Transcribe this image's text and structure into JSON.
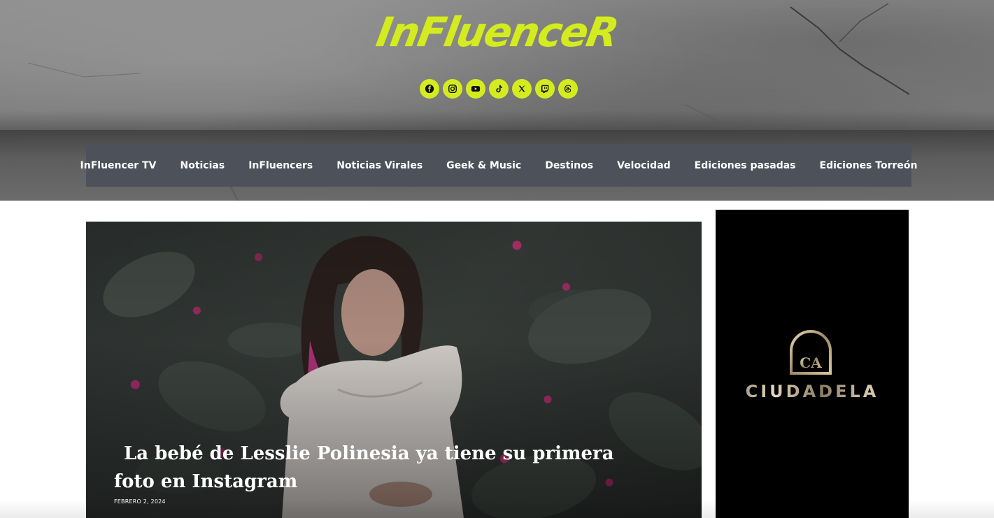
{
  "site": {
    "logo_text": "InFluenceR",
    "brand_color": "#d4ec1f"
  },
  "social": [
    {
      "name": "facebook-icon",
      "glyph": "f"
    },
    {
      "name": "instagram-icon",
      "glyph": "◎"
    },
    {
      "name": "youtube-icon",
      "glyph": "▶"
    },
    {
      "name": "tiktok-icon",
      "glyph": "♪"
    },
    {
      "name": "x-icon",
      "glyph": "𝕏"
    },
    {
      "name": "twitch-icon",
      "glyph": "▣"
    },
    {
      "name": "threads-icon",
      "glyph": "@"
    }
  ],
  "nav": {
    "items": [
      "InFluencer TV",
      "Noticias",
      "InFluencers",
      "Noticias Virales",
      "Geek & Music",
      "Destinos",
      "Velocidad",
      "Ediciones pasadas",
      "Ediciones Torreón"
    ],
    "background": "#4c515a"
  },
  "featured": {
    "title": "La bebé de Lesslie Polinesia ya tiene su primera foto en Instagram",
    "date": "FEBRERO 2, 2024"
  },
  "sidebar_ad": {
    "brand": "CIUDADELA",
    "emblem_letters": "CA"
  }
}
